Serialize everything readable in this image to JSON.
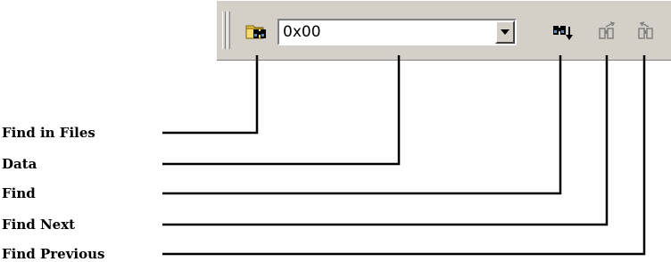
{
  "toolbar": {
    "find_in_files_icon": "folder-binoculars-icon",
    "find_icon": "binoculars-down-arrow-icon",
    "find_next_icon": "binoculars-next-icon",
    "find_previous_icon": "binoculars-previous-icon",
    "dropdown_icon": "chevron-down-icon",
    "data_value": "0x00"
  },
  "callouts": [
    {
      "id": "find-in-files",
      "label": "Find in Files"
    },
    {
      "id": "data",
      "label": "Data"
    },
    {
      "id": "find",
      "label": "Find"
    },
    {
      "id": "find-next",
      "label": "Find Next"
    },
    {
      "id": "find-previous",
      "label": "Find Previous"
    }
  ]
}
